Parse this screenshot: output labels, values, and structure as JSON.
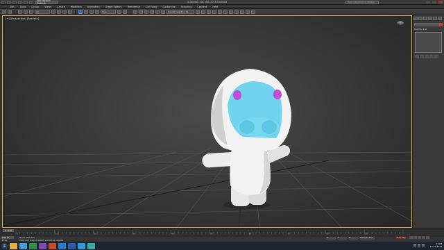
{
  "titlebar": {
    "workspace": "Workspace: Default",
    "app_title": "Autodesk 3ds Max 2016    Untitled",
    "search_placeholder": "Type a keyword or phrase"
  },
  "menu": [
    "Edit",
    "Tools",
    "Group",
    "Views",
    "Create",
    "Modifiers",
    "Animation",
    "Graph Editors",
    "Rendering",
    "Civil View",
    "Customize",
    "Scripting",
    "Content",
    "Help"
  ],
  "toolbar": {
    "filter_value": "All",
    "view_value": "View",
    "selection_set_value": "Create Selection Se"
  },
  "viewport": {
    "label": "[+] [Perspective] [Realistic]",
    "background_color": "#3d3d3d",
    "border_color": "#d8b23a"
  },
  "character": {
    "face_color": "#6fd3ee",
    "eye_color": "#c34ad6",
    "body_color": "#f2f2f2"
  },
  "command_panel": {
    "modifier_list_label": "Modifier List",
    "swatch_color": "#c83c3c"
  },
  "timeline": {
    "frame_display": "0 / 100",
    "ticks": [
      "0",
      "10",
      "20",
      "30",
      "40",
      "50",
      "60",
      "70",
      "80",
      "90",
      "100"
    ]
  },
  "statusbar": {
    "selection_dropdown": "Max to Phys",
    "status_line_1": "None Selected",
    "status_line_2": "Click and drag to select and move objects",
    "coord_x": "X:",
    "coord_y": "Y:",
    "coord_z": "Z:",
    "grid": "Grid = 10,0cm",
    "add_time_tag": "Add Time Tag",
    "auto_key": "Auto Key",
    "selected": "Selected"
  },
  "taskbar": {
    "time": "13:08",
    "date": "13.07.2016",
    "apps": [
      {
        "name": "explorer-icon",
        "color": "#e0b040"
      },
      {
        "name": "chrome-icon",
        "color": "#4a9ad4"
      },
      {
        "name": "excel-icon",
        "color": "#2e8b4a"
      },
      {
        "name": "visual-studio-icon",
        "color": "#7a4ab0"
      },
      {
        "name": "powerpoint-icon",
        "color": "#c84a2a"
      },
      {
        "name": "photoshop-icon",
        "color": "#2a78c8"
      },
      {
        "name": "word-icon",
        "color": "#2a5aa8"
      },
      {
        "name": "skype-icon",
        "color": "#2a9ad8"
      },
      {
        "name": "3dsmax-icon",
        "color": "#3aa8a8"
      }
    ]
  }
}
